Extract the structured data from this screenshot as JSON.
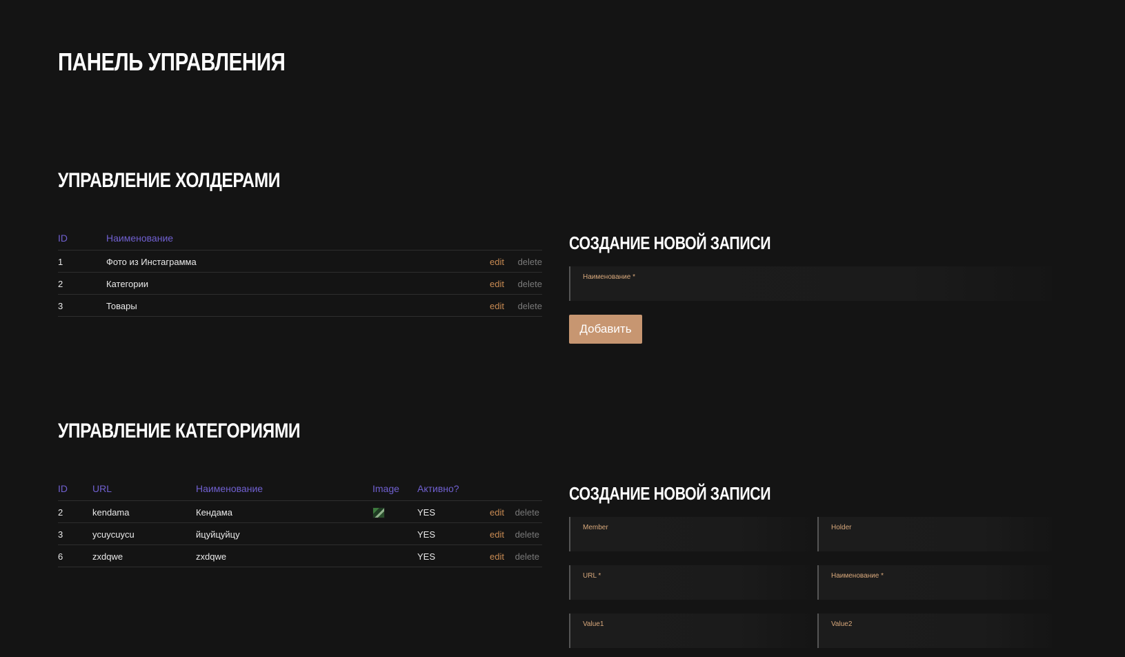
{
  "page_title": "ПАНЕЛЬ УПРАВЛЕНИЯ",
  "holders": {
    "title": "УПРАВЛЕНИЕ ХОЛДЕРАМИ",
    "columns": {
      "id": "ID",
      "name": "Наименование"
    },
    "rows": [
      {
        "id": "1",
        "name": "Фото из Инстаграмма",
        "edit": "edit",
        "delete": "delete"
      },
      {
        "id": "2",
        "name": "Категории",
        "edit": "edit",
        "delete": "delete"
      },
      {
        "id": "3",
        "name": "Товары",
        "edit": "edit",
        "delete": "delete"
      }
    ],
    "form": {
      "title": "СОЗДАНИЕ НОВОЙ ЗАПИСИ",
      "name_label": "Наименование",
      "submit_label": "Добавить"
    }
  },
  "categories": {
    "title": "УПРАВЛЕНИЕ КАТЕГОРИЯМИ",
    "columns": {
      "id": "ID",
      "url": "URL",
      "name": "Наименование",
      "image": "Image",
      "active": "Активно?"
    },
    "rows": [
      {
        "id": "2",
        "url": "kendama",
        "name": "Кендама",
        "has_image": true,
        "active": "YES",
        "edit": "edit",
        "delete": "delete"
      },
      {
        "id": "3",
        "url": "ycuycuycu",
        "name": "йцуйцуйцу",
        "has_image": false,
        "active": "YES",
        "edit": "edit",
        "delete": "delete"
      },
      {
        "id": "6",
        "url": "zxdqwe",
        "name": "zxdqwe",
        "has_image": false,
        "active": "YES",
        "edit": "edit",
        "delete": "delete"
      }
    ],
    "form": {
      "title": "СОЗДАНИЕ НОВОЙ ЗАПИСИ",
      "member_label": "Member",
      "holder_label": "Holder",
      "url_label": "URL",
      "name_label": "Наименование",
      "value1_label": "Value1",
      "value2_label": "Value2"
    }
  },
  "required_mark": "*",
  "colors": {
    "background": "#141414",
    "header_text": "#7060d0",
    "edit_link": "#c88a52",
    "delete_link": "#7a7a7a",
    "field_label": "#d9a97c",
    "button": "#c79671"
  }
}
